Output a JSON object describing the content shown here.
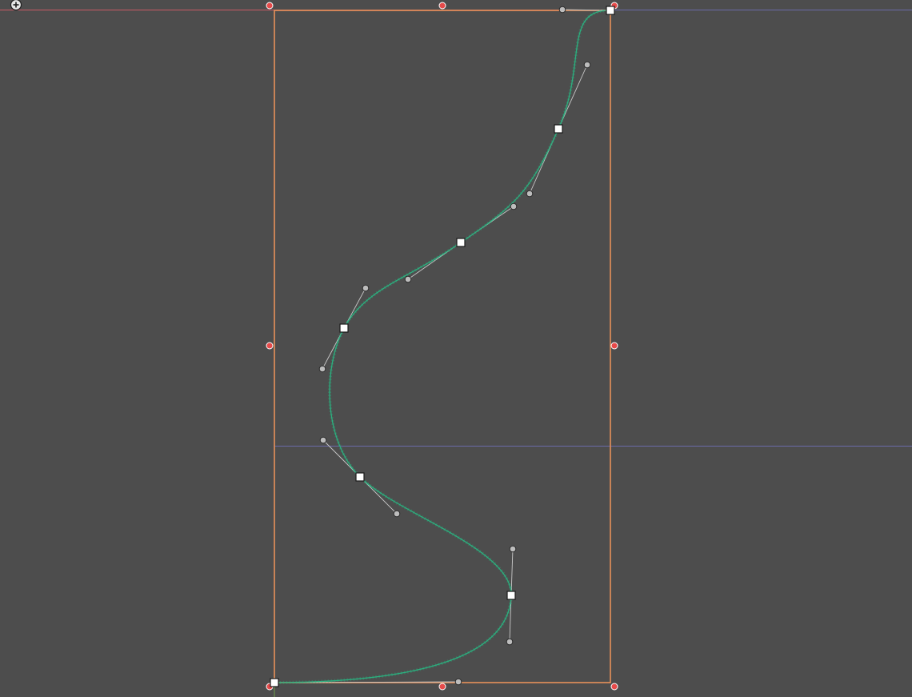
{
  "canvas": {
    "background": "#4d4d4d",
    "curve_color": "#2bb07f",
    "bounding_box_color": "#e8915a",
    "guide_horizontal_color": "#c85a64",
    "guide_secondary_color": "#6a6aa8",
    "bound_handle_color": "#e64a4a",
    "anchor_fill": "#ffffff",
    "handle_fill": "#bdbdbd"
  },
  "toolbar": {
    "add_point_icon": "plus-circle-icon"
  },
  "curve": {
    "anchor_count": 7,
    "handle_count": 12
  }
}
